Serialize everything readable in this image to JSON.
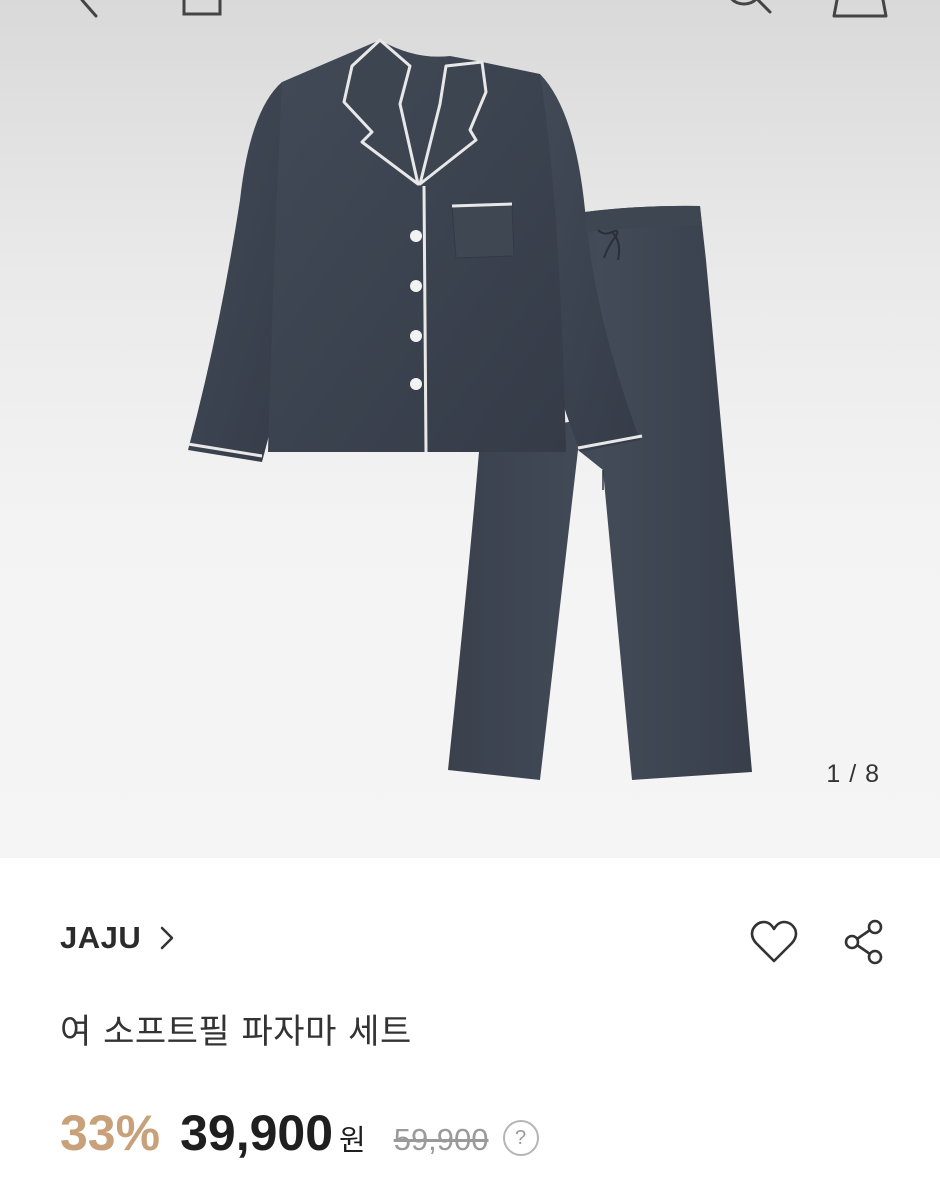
{
  "header": {
    "back_icon": "chevron-left-icon",
    "home_icon": "home-icon",
    "search_icon": "search-icon",
    "cart_icon": "shopping-bag-icon"
  },
  "gallery": {
    "current": 1,
    "total": 8,
    "counter_text": "1 / 8",
    "garment_color": "#3b4350",
    "piping_color": "#e8e8e8"
  },
  "product": {
    "brand": "JAJU",
    "brand_chevron_icon": "chevron-right-icon",
    "title": "여 소프트필 파자마 세트",
    "wishlist_icon": "heart-icon",
    "share_icon": "share-icon"
  },
  "pricing": {
    "discount": "33%",
    "sale_price": "39,900",
    "currency": "원",
    "original_price": "59,900",
    "info_icon": "help-icon",
    "info_text": "?",
    "discount_color": "#c8a17a"
  }
}
